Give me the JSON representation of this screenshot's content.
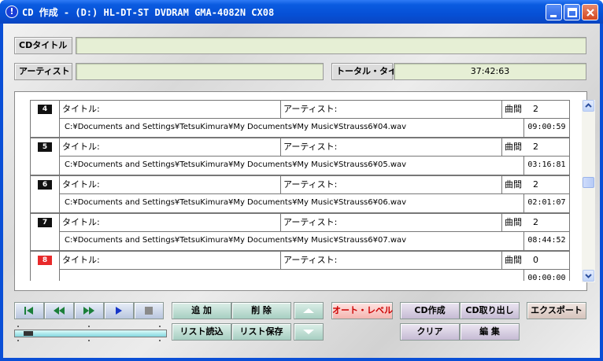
{
  "window": {
    "title": "CD 作成 - (D:) HL-DT-ST DVDRAM GMA-4082N CX08",
    "title_icon": "!"
  },
  "header": {
    "cd_title_label": "CDタイトル",
    "cd_title_value": "",
    "artist_label": "アーティスト",
    "artist_value": "",
    "total_time_label": "トータル・タイム",
    "total_time_value": "37:42:63"
  },
  "tracks": [
    {
      "no": "4",
      "title_label": "タイトル:",
      "title": "",
      "artist_label": "アーティスト:",
      "artist": "",
      "count_label": "曲間",
      "count": "2",
      "path": "C:¥Documents and Settings¥TetsuKimura¥My Documents¥My Music¥Strauss6¥04.wav",
      "time": "09:00:59",
      "active": false
    },
    {
      "no": "5",
      "title_label": "タイトル:",
      "title": "",
      "artist_label": "アーティスト:",
      "artist": "",
      "count_label": "曲間",
      "count": "2",
      "path": "C:¥Documents and Settings¥TetsuKimura¥My Documents¥My Music¥Strauss6¥05.wav",
      "time": "03:16:81",
      "active": false
    },
    {
      "no": "6",
      "title_label": "タイトル:",
      "title": "",
      "artist_label": "アーティスト:",
      "artist": "",
      "count_label": "曲間",
      "count": "2",
      "path": "C:¥Documents and Settings¥TetsuKimura¥My Documents¥My Music¥Strauss6¥06.wav",
      "time": "02:01:07",
      "active": false
    },
    {
      "no": "7",
      "title_label": "タイトル:",
      "title": "",
      "artist_label": "アーティスト:",
      "artist": "",
      "count_label": "曲間",
      "count": "2",
      "path": "C:¥Documents and Settings¥TetsuKimura¥My Documents¥My Music¥Strauss6¥07.wav",
      "time": "08:44:52",
      "active": false
    },
    {
      "no": "8",
      "title_label": "タイトル:",
      "title": "",
      "artist_label": "アーティスト:",
      "artist": "",
      "count_label": "曲間",
      "count": "0",
      "path": "",
      "time": "00:00:00",
      "active": true
    }
  ],
  "transport": {
    "icons": [
      "skip-to-start-icon",
      "rewind-icon",
      "fast-forward-icon",
      "play-icon",
      "stop-icon"
    ],
    "level": 0.05
  },
  "buttons": {
    "add": "追 加",
    "delete": "削 除",
    "load_list": "リスト読込",
    "save_list": "リスト保存",
    "auto_level": "オート・レベル",
    "create_cd": "CD作成",
    "eject_cd": "CD取り出し",
    "export": "エクスポート",
    "clear": "クリア",
    "edit": "編 集"
  },
  "colors": {
    "title_bar": "#0a5be0",
    "field_bg": "#e6efd5",
    "active_track": "#e8292a",
    "auto_level_text": "#cc0000"
  }
}
